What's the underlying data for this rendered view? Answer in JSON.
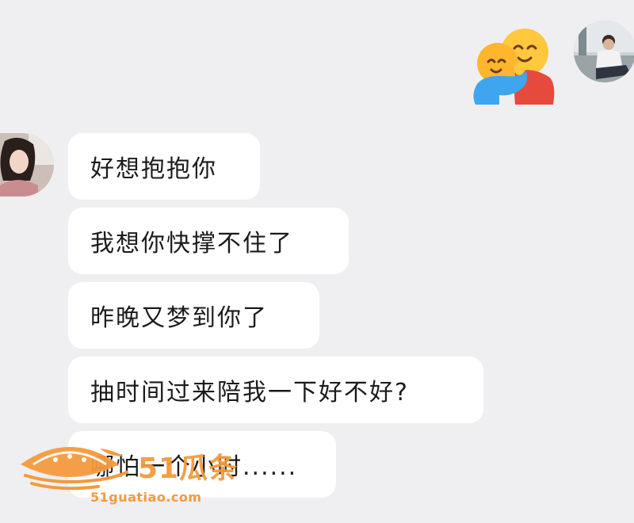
{
  "outgoing": {
    "sticker": "hugging-face-emoji",
    "avatar": "man-sitting-photo"
  },
  "incoming": {
    "avatar": "woman-in-car-photo",
    "messages": [
      "好想抱抱你",
      "我想你快撑不住了",
      "昨晚又梦到你了",
      "抽时间过来陪我一下好不好?",
      "哪怕一个小时......"
    ]
  },
  "watermark": {
    "brand": "51瓜条",
    "site": "51guatiao.com",
    "logo": "watermelon-logo",
    "color": "#f39a3e"
  },
  "colors": {
    "background": "#efeff1",
    "bubble": "#ffffff",
    "text": "#1b1b1b"
  }
}
